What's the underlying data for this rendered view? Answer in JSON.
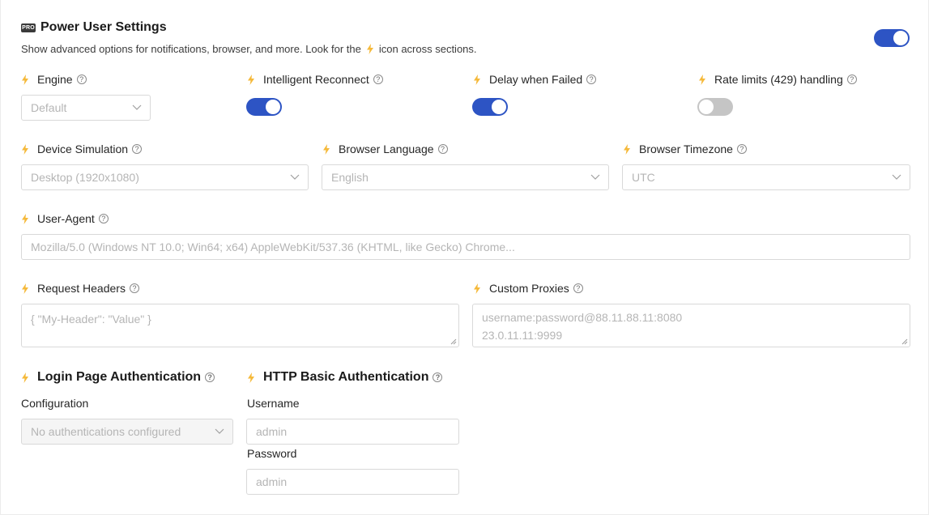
{
  "header": {
    "badge": "PRO",
    "title": "Power User Settings",
    "subtitle_before": "Show advanced options for notifications, browser, and more. Look for the",
    "subtitle_after": "icon across sections."
  },
  "master_toggle": {
    "on": true
  },
  "row1": {
    "engine": {
      "label": "Engine",
      "value": "Default"
    },
    "intelligent_reconnect": {
      "label": "Intelligent Reconnect",
      "on": true
    },
    "delay_when_failed": {
      "label": "Delay when Failed",
      "on": true
    },
    "rate_limits": {
      "label": "Rate limits (429) handling",
      "on": false
    }
  },
  "row2": {
    "device_simulation": {
      "label": "Device Simulation",
      "value": "Desktop (1920x1080)"
    },
    "browser_language": {
      "label": "Browser Language",
      "value": "English"
    },
    "browser_timezone": {
      "label": "Browser Timezone",
      "value": "UTC"
    }
  },
  "user_agent": {
    "label": "User-Agent",
    "placeholder": "Mozilla/5.0 (Windows NT 10.0; Win64; x64) AppleWebKit/537.36 (KHTML, like Gecko) Chrome..."
  },
  "request_headers": {
    "label": "Request Headers",
    "placeholder": "{ \"My-Header\": \"Value\" }"
  },
  "custom_proxies": {
    "label": "Custom Proxies",
    "placeholder_lines": [
      "username:password@88.11.88.11:8080",
      "23.0.11.11:9999"
    ]
  },
  "login_auth": {
    "title": "Login Page Authentication",
    "config_label": "Configuration",
    "config_value": "No authentications configured"
  },
  "http_auth": {
    "title": "HTTP Basic Authentication",
    "username_label": "Username",
    "username_placeholder": "admin",
    "password_label": "Password",
    "password_placeholder": "admin"
  },
  "colors": {
    "accent": "#2d54c4",
    "bolt": "#f5b93a",
    "toggle_off": "#c5c5c5"
  },
  "icons": {
    "bolt": "lightning-bolt-icon",
    "help": "question-circle-icon",
    "chevron": "chevron-down-icon"
  }
}
